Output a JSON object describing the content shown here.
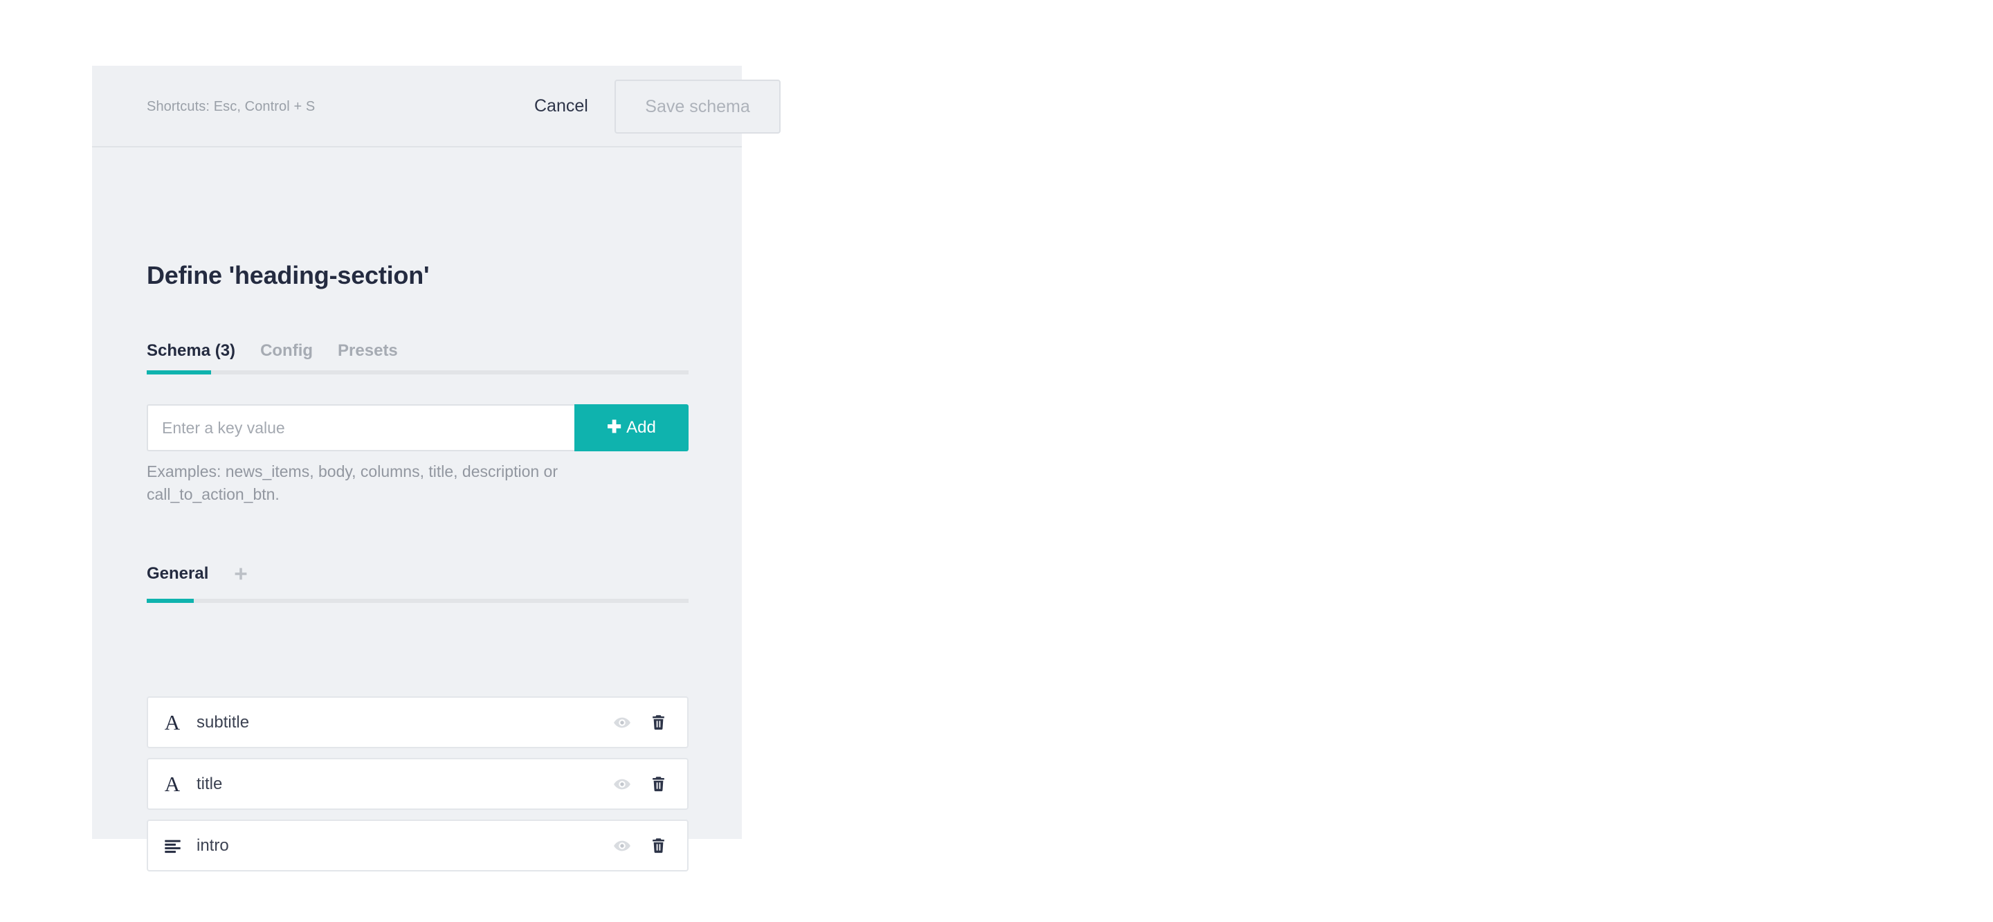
{
  "header": {
    "shortcuts_text": "Shortcuts: Esc, Control + S",
    "cancel_label": "Cancel",
    "save_label": "Save schema"
  },
  "page": {
    "title": "Define 'heading-section'"
  },
  "main_tabs": {
    "items": [
      {
        "label": "Schema (3)",
        "active": true
      },
      {
        "label": "Config",
        "active": false
      },
      {
        "label": "Presets",
        "active": false
      }
    ]
  },
  "key_form": {
    "placeholder": "Enter a key value",
    "value": "",
    "add_label": "Add",
    "add_icon": "plus-icon",
    "plus_glyph": "✚",
    "examples": "Examples: news_items, body, columns, title, description or call_to_action_btn."
  },
  "group_tabs": {
    "items": [
      {
        "label": "General",
        "active": true
      }
    ],
    "add_group_icon": "plus-icon"
  },
  "fields": [
    {
      "name": "subtitle",
      "type_icon": "text-field-icon",
      "preview_icon": "eye-icon",
      "delete_icon": "trash-icon"
    },
    {
      "name": "title",
      "type_icon": "text-field-icon",
      "preview_icon": "eye-icon",
      "delete_icon": "trash-icon"
    },
    {
      "name": "intro",
      "type_icon": "rich-text-icon",
      "preview_icon": "eye-icon",
      "delete_icon": "trash-icon"
    }
  ],
  "colors": {
    "accent": "#0fb3ae",
    "panel_bg": "#eff1f4",
    "heading": "#242b40",
    "muted_text": "#9297a0",
    "row_bg": "#ffffff",
    "row_border": "#e3e6ea",
    "trash_icon": "#2d3448",
    "eye_icon": "#d5d8dd"
  }
}
